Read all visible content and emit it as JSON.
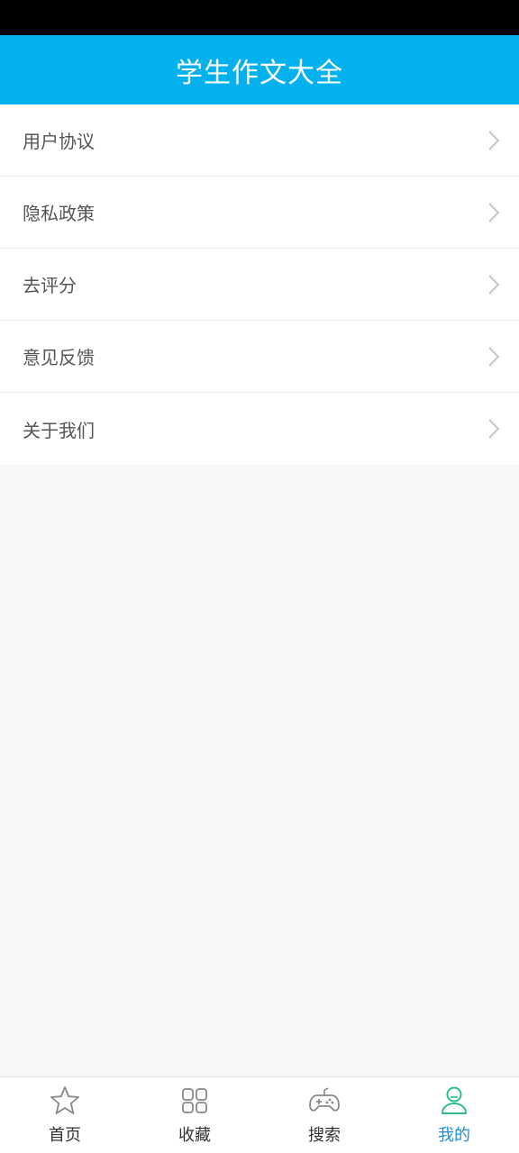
{
  "header": {
    "title": "学生作文大全"
  },
  "menu": {
    "items": [
      {
        "label": "用户协议"
      },
      {
        "label": "隐私政策"
      },
      {
        "label": "去评分"
      },
      {
        "label": "意见反馈"
      },
      {
        "label": "关于我们"
      }
    ]
  },
  "tabbar": {
    "active": "我的",
    "tabs": [
      {
        "label": "首页",
        "icon": "star-icon"
      },
      {
        "label": "收藏",
        "icon": "grid-icon"
      },
      {
        "label": "搜索",
        "icon": "gamepad-icon"
      },
      {
        "label": "我的",
        "icon": "user-icon"
      }
    ]
  },
  "colors": {
    "header_bg": "#03b1ee",
    "active_tab": "#1a8fd8",
    "active_icon": "#2ebd8b",
    "inactive_icon": "#888888"
  }
}
